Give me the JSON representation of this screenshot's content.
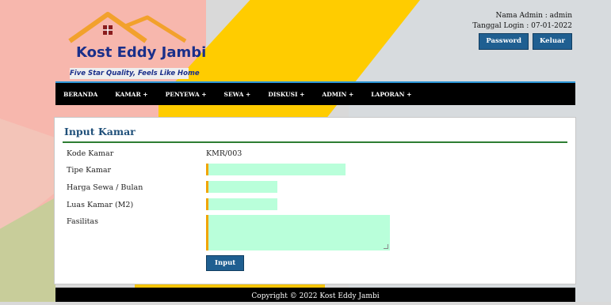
{
  "brand": {
    "title": "Kost Eddy Jambi",
    "tagline": "Five Star Quality, Feels Like Home"
  },
  "admin": {
    "name_line": "Nama Admin : admin",
    "login_line": "Tanggal Login : 07-01-2022",
    "password_label": "Password",
    "logout_label": "Keluar"
  },
  "nav": {
    "items": [
      {
        "label": "BERANDA"
      },
      {
        "label": "KAMAR +"
      },
      {
        "label": "PENYEWA +"
      },
      {
        "label": "SEWA +"
      },
      {
        "label": "DISKUSI +"
      },
      {
        "label": "ADMIN +"
      },
      {
        "label": "LAPORAN +"
      }
    ]
  },
  "form": {
    "title": "Input Kamar",
    "kode_label": "Kode Kamar",
    "kode_value": "KMR/003",
    "tipe_label": "Tipe Kamar",
    "tipe_value": "",
    "harga_label": "Harga Sewa / Bulan",
    "harga_value": "",
    "luas_label": "Luas Kamar (M2)",
    "luas_value": "",
    "fasilitas_label": "Fasilitas",
    "fasilitas_value": "",
    "submit_label": "Input"
  },
  "footer": {
    "text": "Copyright © 2022 Kost Eddy Jambi"
  },
  "colors": {
    "accent": "#1f5f91",
    "field_bg": "#b9ffda",
    "field_marker": "#f0a500",
    "nav_bg": "#000000",
    "panel_rule": "#2e7d32"
  }
}
